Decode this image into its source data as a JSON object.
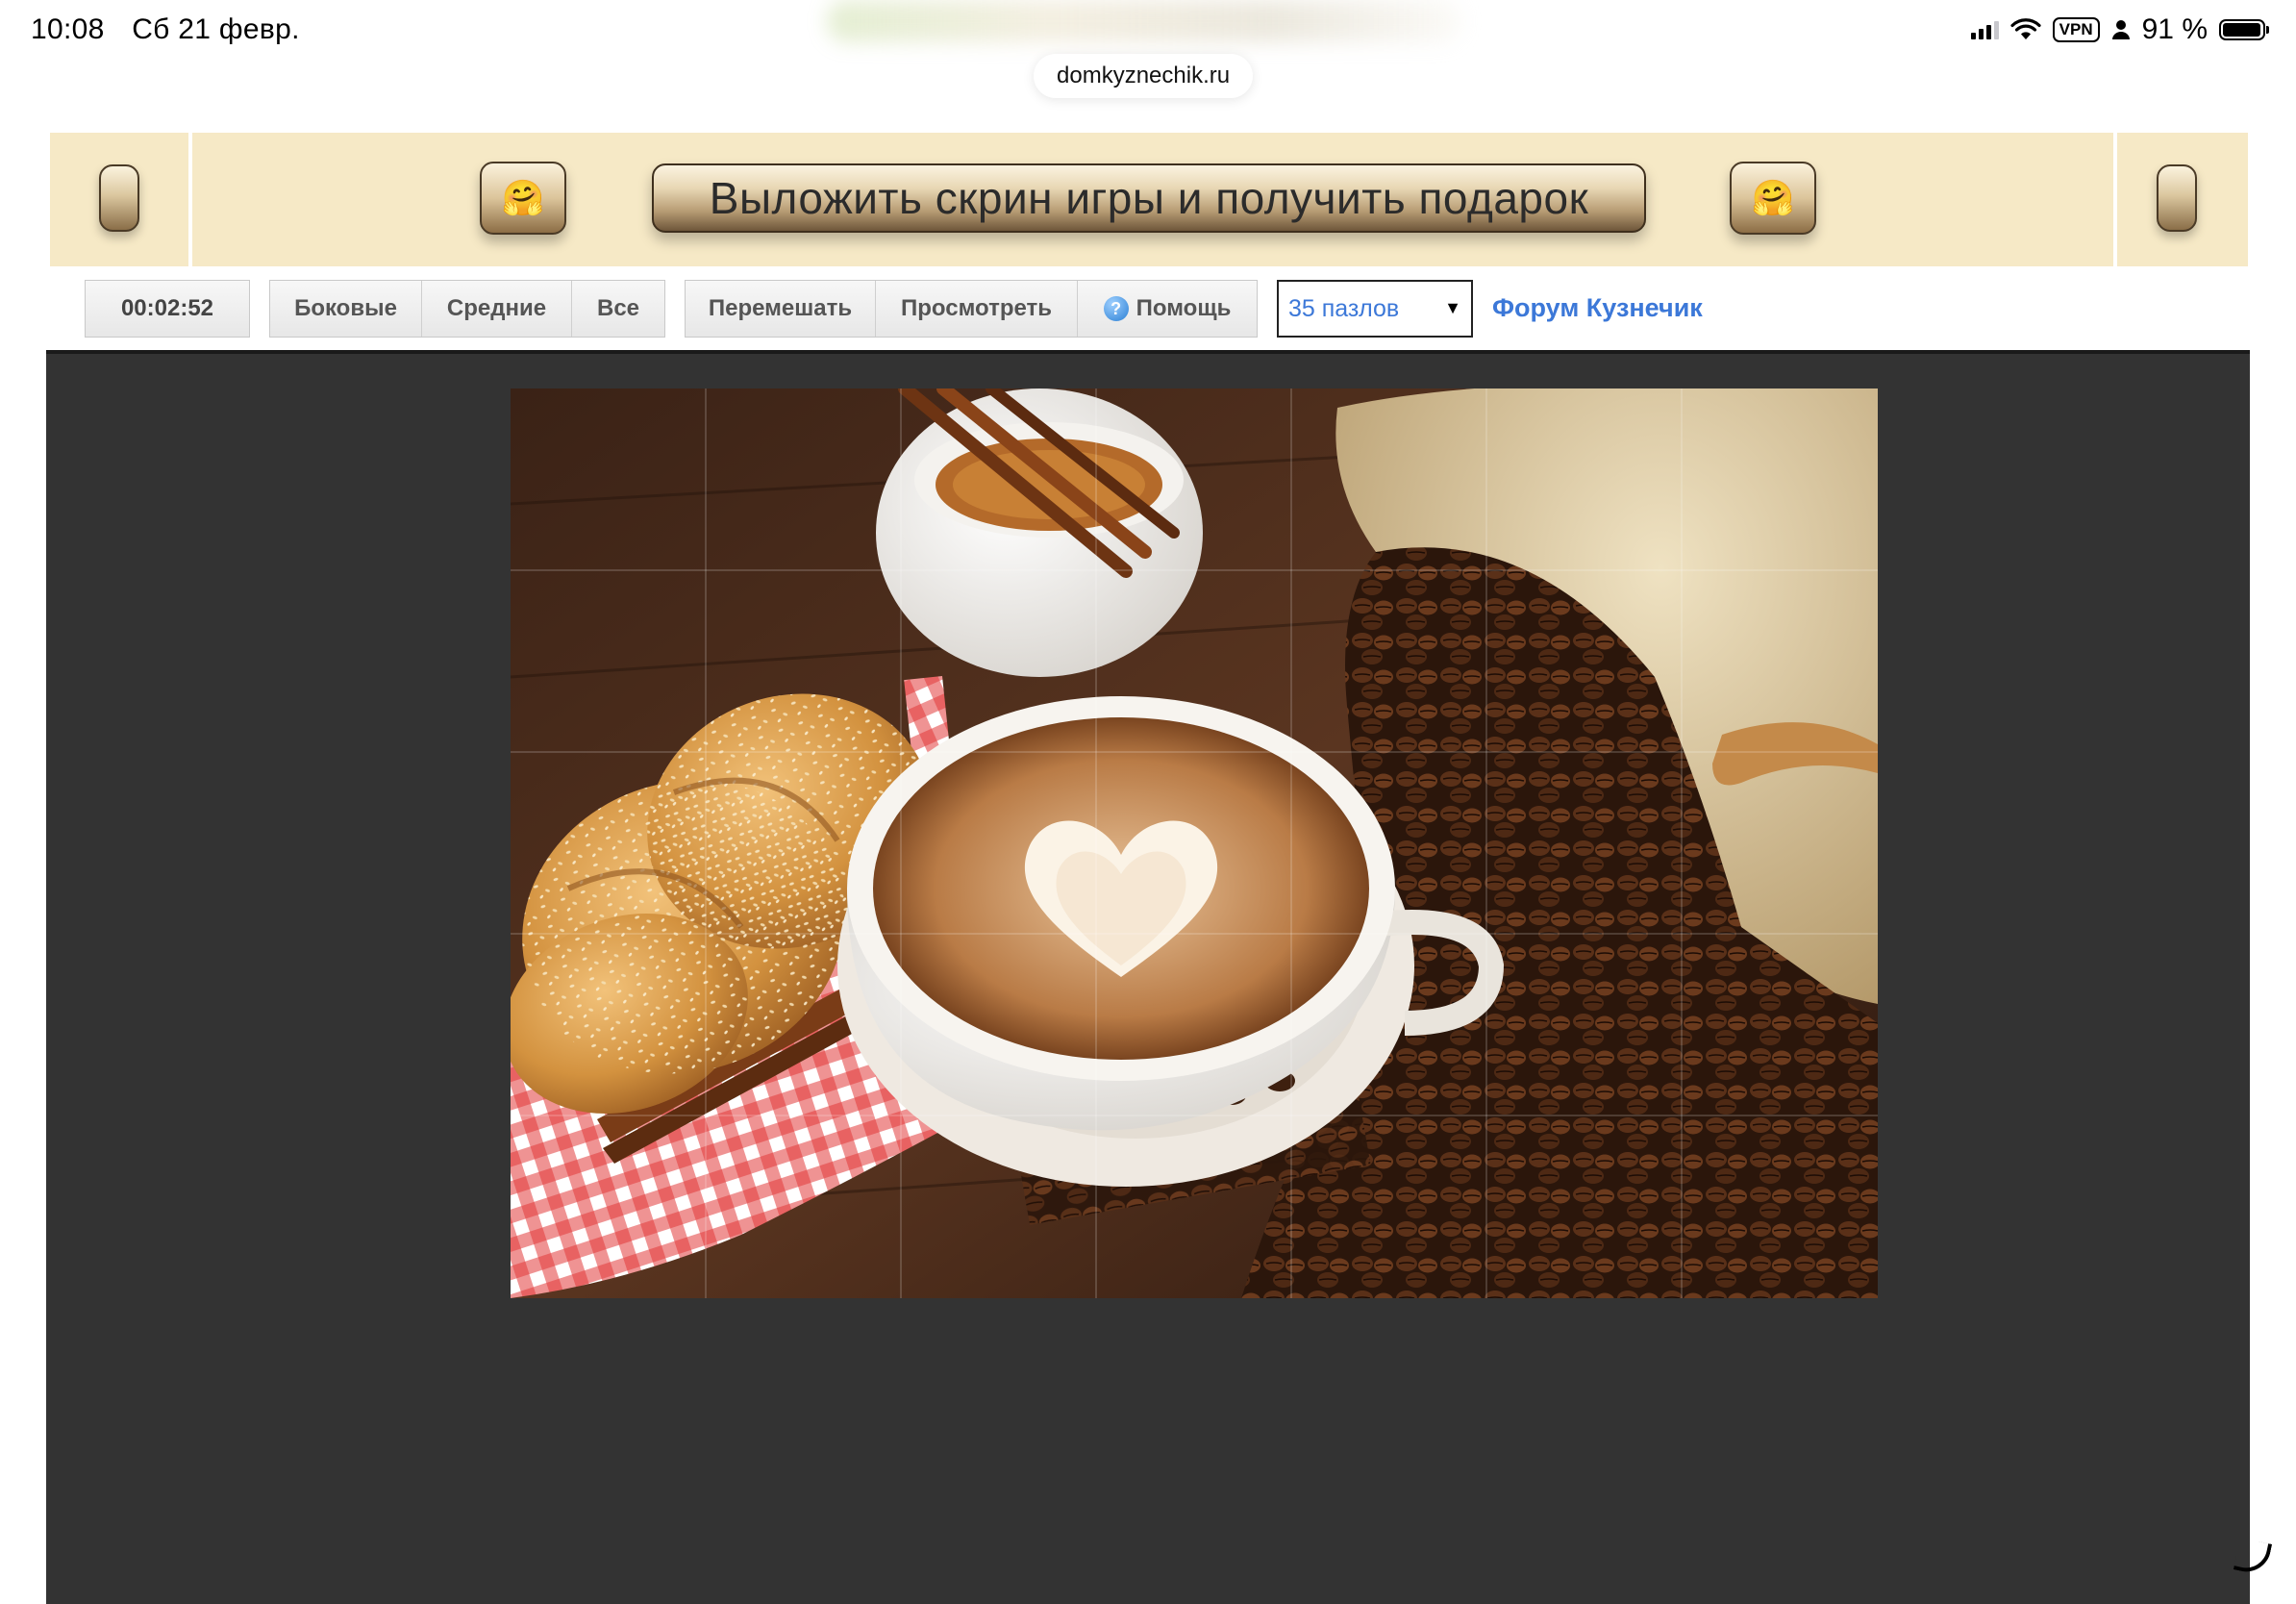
{
  "status_bar": {
    "time": "10:08",
    "date": "Сб 21 февр.",
    "vpn": "VPN",
    "battery": "91 %"
  },
  "browser": {
    "url": "domkyznechik.ru"
  },
  "banner": {
    "promo_label": "Выложить скрин игры и получить подарок",
    "smiley": "🤗"
  },
  "toolbar": {
    "timer": "00:02:52",
    "filter_buttons": [
      "Боковые",
      "Средние",
      "Все"
    ],
    "action_buttons": {
      "shuffle": "Перемешать",
      "preview": "Просмотреть",
      "help": "Помощь"
    },
    "piece_select": {
      "selected": "35 пазлов"
    },
    "forum_link": "Форум Кузнечик"
  },
  "puzzle": {
    "rows": 5,
    "cols": 7,
    "pieces": 35,
    "image_subject": "latte-art-coffee-cup-bread-coffee-beans"
  },
  "colors": {
    "banner_bg": "#f6e9c6",
    "board_bg": "#333333",
    "link": "#3c78d8"
  }
}
